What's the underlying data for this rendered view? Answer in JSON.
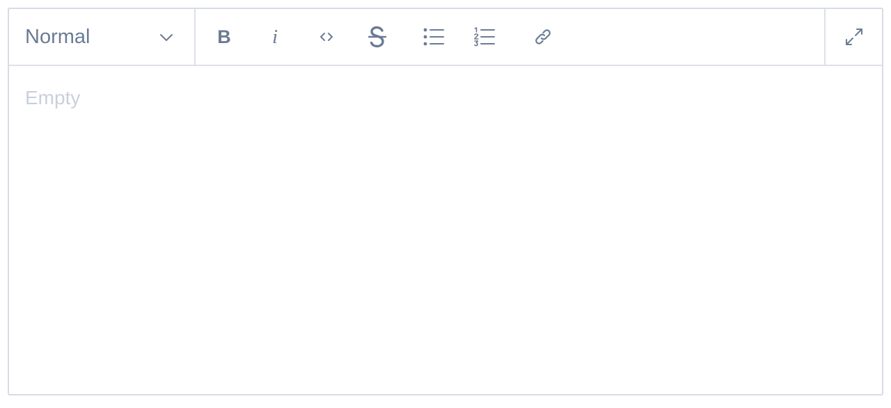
{
  "toolbar": {
    "format_select": {
      "selected": "Normal",
      "chevron_icon": "chevron-down-icon"
    },
    "buttons": [
      {
        "icon": "bold-icon",
        "glyph": "B"
      },
      {
        "icon": "italic-icon",
        "glyph": "i"
      },
      {
        "icon": "code-icon"
      },
      {
        "icon": "strikethrough-icon"
      },
      {
        "icon": "bullet-list-icon"
      },
      {
        "icon": "numbered-list-icon"
      },
      {
        "icon": "link-icon"
      }
    ],
    "fullscreen_icon": "expand-icon"
  },
  "editor": {
    "placeholder": "Empty"
  },
  "colors": {
    "icon": "#6b7b95",
    "border": "#d6dbe4",
    "divider": "#dde1e8",
    "placeholder": "#c9d0dc"
  }
}
